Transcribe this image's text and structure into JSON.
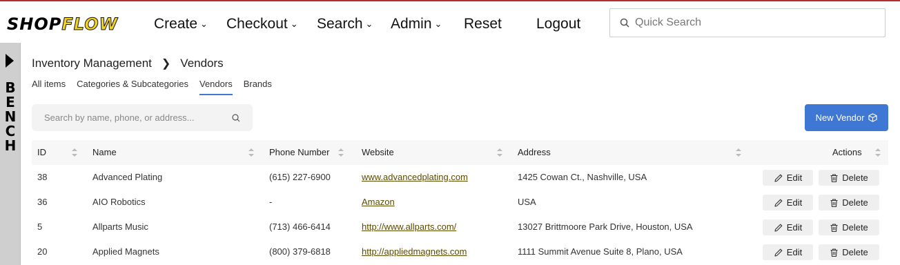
{
  "header": {
    "logo_part1": "SHOP",
    "logo_part2": "FLOW",
    "nav": [
      {
        "label": "Create",
        "has_dropdown": true
      },
      {
        "label": "Checkout",
        "has_dropdown": true
      },
      {
        "label": "Search",
        "has_dropdown": true
      },
      {
        "label": "Admin",
        "has_dropdown": true
      },
      {
        "label": "Reset",
        "has_dropdown": false
      },
      {
        "label": "Logout",
        "has_dropdown": false
      }
    ],
    "quick_search_placeholder": "Quick Search"
  },
  "bench": {
    "letters": [
      "B",
      "E",
      "N",
      "C",
      "H"
    ]
  },
  "breadcrumb": {
    "parent": "Inventory Management",
    "current": "Vendors"
  },
  "tabs": [
    "All items",
    "Categories & Subcategories",
    "Vendors",
    "Brands"
  ],
  "active_tab": "Vendors",
  "search": {
    "placeholder": "Search by name, phone, or address..."
  },
  "new_vendor_label": "New Vendor",
  "table": {
    "columns": [
      "ID",
      "Name",
      "Phone Number",
      "Website",
      "Address",
      "Actions"
    ],
    "rows": [
      {
        "id": "38",
        "name": "Advanced Plating",
        "phone": "(615) 227-6900",
        "website": "www.advancedplating.com",
        "address": "1425 Cowan Ct., Nashville, USA"
      },
      {
        "id": "36",
        "name": "AIO Robotics",
        "phone": "-",
        "website": "Amazon",
        "address": "USA"
      },
      {
        "id": "5",
        "name": "Allparts Music",
        "phone": "(713) 466-6414",
        "website": "http://www.allparts.com/",
        "address": "13027 Brittmoore Park Drive, Houston, USA"
      },
      {
        "id": "20",
        "name": "Applied Magnets",
        "phone": "(800) 379-6818",
        "website": "http://appliedmagnets.com",
        "address": "1111 Summit Avenue Suite 8, Plano, USA"
      }
    ],
    "edit_label": "Edit",
    "delete_label": "Delete"
  },
  "colors": {
    "accent": "#3f77d4",
    "logo_yellow": "#f2d21f",
    "bench_bg": "#cfcfcf"
  }
}
